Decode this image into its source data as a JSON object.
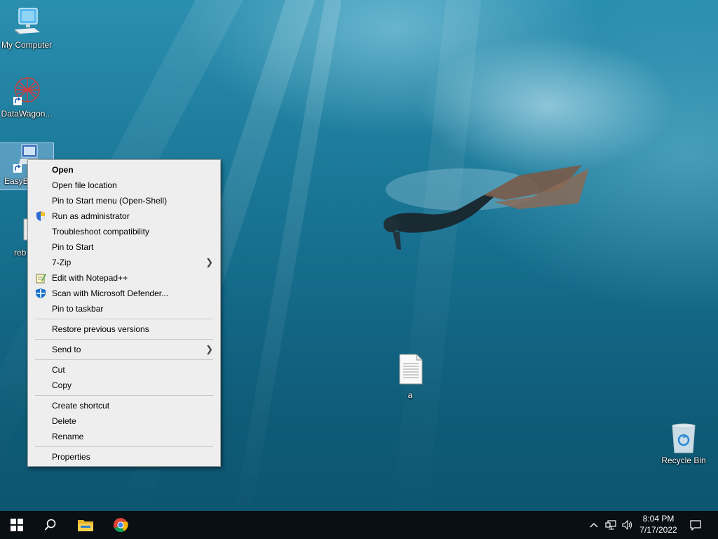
{
  "desktop": {
    "icons": [
      {
        "label": "My Computer"
      },
      {
        "label": "DataWagon..."
      },
      {
        "label": "EasyB"
      },
      {
        "label": "reb"
      },
      {
        "label": "a"
      },
      {
        "label": "Recycle Bin"
      }
    ]
  },
  "context_menu": {
    "items": [
      {
        "label": "Open",
        "bold": true
      },
      {
        "label": "Open file location"
      },
      {
        "label": "Pin to Start menu (Open-Shell)"
      },
      {
        "label": "Run as administrator",
        "icon": "uac-shield-icon"
      },
      {
        "label": "Troubleshoot compatibility"
      },
      {
        "label": "Pin to Start"
      },
      {
        "label": "7-Zip",
        "submenu": true
      },
      {
        "label": "Edit with Notepad++",
        "icon": "notepad-plus-plus-icon"
      },
      {
        "label": "Scan with Microsoft Defender...",
        "icon": "defender-icon"
      },
      {
        "label": "Pin to taskbar"
      },
      {
        "label": "Restore previous versions"
      },
      {
        "label": "Send to",
        "submenu": true
      },
      {
        "label": "Cut"
      },
      {
        "label": "Copy"
      },
      {
        "label": "Create shortcut"
      },
      {
        "label": "Delete"
      },
      {
        "label": "Rename"
      },
      {
        "label": "Properties"
      }
    ]
  },
  "taskbar": {
    "time": "8:04 PM",
    "date": "7/17/2022",
    "buttons": [
      "start-icon",
      "search-icon",
      "file-explorer-icon",
      "chrome-icon"
    ],
    "tray": [
      "chevron-up-icon",
      "network-icon",
      "volume-icon",
      "action-center-icon"
    ]
  },
  "colors": {
    "menu_bg": "#eeeeee",
    "taskbar_bg": "#0a0f14",
    "water": "#146b8a"
  }
}
